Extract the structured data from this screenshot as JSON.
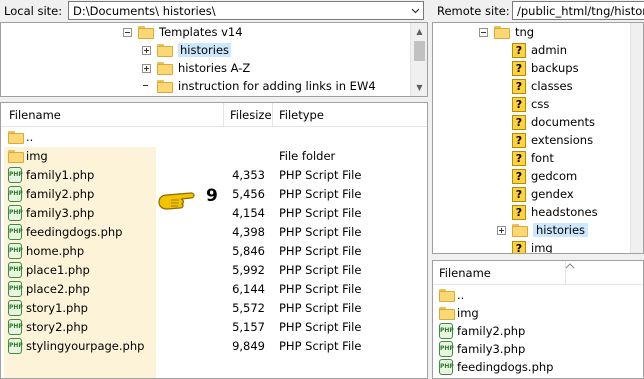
{
  "local_bar": {
    "caption": "Local site:",
    "path": "D:\\Documents\\ histories\\"
  },
  "remote_bar": {
    "caption": "Remote site:",
    "path": "/public_html/tng/histori"
  },
  "local_tree": [
    {
      "label": "Templates v14",
      "expander": "minus"
    },
    {
      "label": "histories",
      "expander": "plus",
      "selected": true
    },
    {
      "label": "histories A-Z",
      "expander": "plus"
    },
    {
      "label": "instruction for adding links in EW4",
      "expander": "none"
    }
  ],
  "remote_tree": [
    {
      "label": "tng",
      "expander": "minus",
      "icon": "folder"
    },
    {
      "label": "admin",
      "icon": "question"
    },
    {
      "label": "backups",
      "icon": "question"
    },
    {
      "label": "classes",
      "icon": "question"
    },
    {
      "label": "css",
      "icon": "question"
    },
    {
      "label": "documents",
      "icon": "question"
    },
    {
      "label": "extensions",
      "icon": "question"
    },
    {
      "label": "font",
      "icon": "question"
    },
    {
      "label": "gedcom",
      "icon": "question"
    },
    {
      "label": "gendex",
      "icon": "question"
    },
    {
      "label": "headstones",
      "icon": "question"
    },
    {
      "label": "histories",
      "icon": "folder",
      "expander": "plus",
      "selected": true
    },
    {
      "label": "img",
      "icon": "question"
    }
  ],
  "local_list": {
    "headers": {
      "filename": "Filename",
      "filesize": "Filesize",
      "filetype": "Filetype"
    },
    "rows": [
      {
        "name": "..",
        "size": "",
        "type": "",
        "icon": "folder"
      },
      {
        "name": "img",
        "size": "",
        "type": "File folder",
        "icon": "folder"
      },
      {
        "name": "family1.php",
        "size": "4,353",
        "type": "PHP Script File",
        "icon": "php"
      },
      {
        "name": "family2.php",
        "size": "5,456",
        "type": "PHP Script File",
        "icon": "php"
      },
      {
        "name": "family3.php",
        "size": "4,154",
        "type": "PHP Script File",
        "icon": "php"
      },
      {
        "name": "feedingdogs.php",
        "size": "4,398",
        "type": "PHP Script File",
        "icon": "php"
      },
      {
        "name": "home.php",
        "size": "5,846",
        "type": "PHP Script File",
        "icon": "php"
      },
      {
        "name": "place1.php",
        "size": "5,992",
        "type": "PHP Script File",
        "icon": "php"
      },
      {
        "name": "place2.php",
        "size": "6,144",
        "type": "PHP Script File",
        "icon": "php"
      },
      {
        "name": "story1.php",
        "size": "5,572",
        "type": "PHP Script File",
        "icon": "php"
      },
      {
        "name": "story2.php",
        "size": "5,157",
        "type": "PHP Script File",
        "icon": "php"
      },
      {
        "name": "stylingyourpage.php",
        "size": "9,849",
        "type": "PHP Script File",
        "icon": "php"
      }
    ]
  },
  "remote_list": {
    "headers": {
      "filename": "Filename"
    },
    "rows": [
      {
        "name": "..",
        "icon": "folder"
      },
      {
        "name": "img",
        "icon": "folder"
      },
      {
        "name": "family2.php",
        "icon": "php"
      },
      {
        "name": "family3.php",
        "icon": "php"
      },
      {
        "name": "feedingdogs.php",
        "icon": "php"
      }
    ]
  },
  "annotation": {
    "number": "9",
    "icon": "pointing-hand-icon"
  },
  "icon_text": {
    "php": "PHP"
  }
}
